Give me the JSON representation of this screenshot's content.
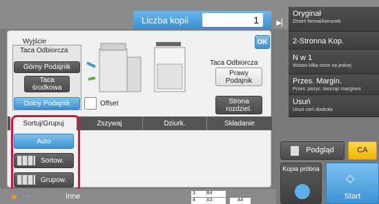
{
  "copies": {
    "label": "Liczba kopii",
    "value": "1"
  },
  "dialog": {
    "title": "Wyjście",
    "ok": "OK",
    "output_tray_group": "Taca Odbiorcza",
    "trays": [
      "Górny Podajnik",
      "Taca\nśrodkowa",
      "Dolny Podajnik"
    ],
    "offset": "Offset",
    "right_tray_label": "Taca Odbiorcza",
    "right_tray_btn": "Prawy\nPodajnik",
    "page_separator": "Strona\nrozdziel."
  },
  "tabs": [
    "Sortuj/Grupuj",
    "Zszywaj",
    "Dziurk.",
    "Składanie"
  ],
  "sort_options": [
    "Auto",
    "Sortow.",
    "Grupow."
  ],
  "sidebar": [
    {
      "title": "Oryginał",
      "sub": "Zmień format/kierunek"
    },
    {
      "title": "2-Stronna Kop.",
      "sub": ""
    },
    {
      "title": "N w 1",
      "sub": "Wstaw kilka stron na jednej"
    },
    {
      "title": "Przes. Margin.",
      "sub": "Przes. pozyc. tworząc margines"
    },
    {
      "title": "Usuń",
      "sub": "Usuń cień dookoła"
    }
  ],
  "preview": "Podgląd",
  "ca": "CA",
  "proof_copy": "Kopia próbna",
  "start": "Start",
  "other": "Inne",
  "paper": {
    "rows": [
      {
        "n": "3",
        "size": "B4"
      },
      {
        "n": "4",
        "size": "A3"
      }
    ],
    "selected": "A4"
  },
  "colors": {
    "accent": "#3c93d6",
    "highlight": "#d0143c"
  }
}
